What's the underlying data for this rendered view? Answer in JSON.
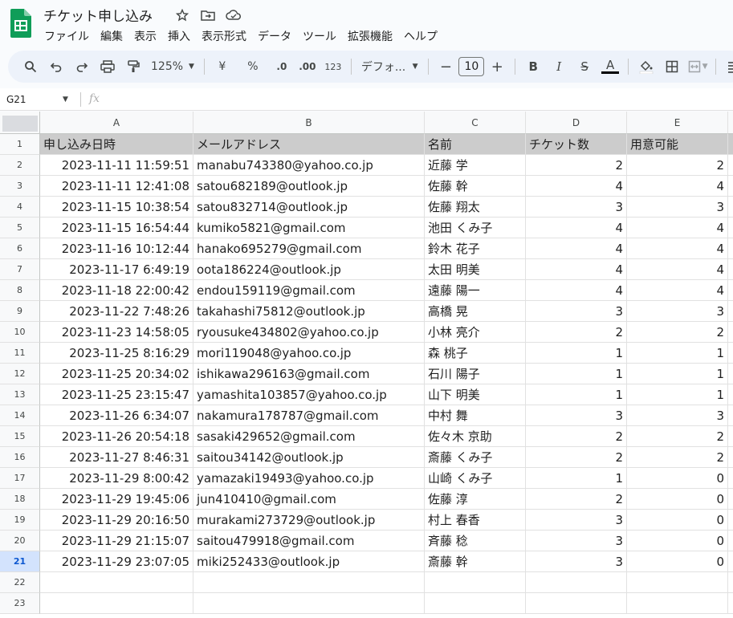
{
  "doc": {
    "title": "チケット申し込み",
    "icons": [
      "star-icon",
      "move-to-folder-icon",
      "cloud-status-icon"
    ]
  },
  "menu": [
    "ファイル",
    "編集",
    "表示",
    "挿入",
    "表示形式",
    "データ",
    "ツール",
    "拡張機能",
    "ヘルプ"
  ],
  "toolbar": {
    "zoom": "125%",
    "currency": "¥",
    "percent": "%",
    "decrease_decimal": ".0",
    "increase_decimal": ".00",
    "format_123": "123",
    "font": "デフォ...",
    "font_size": "10"
  },
  "formula_bar": {
    "cell_ref": "G21",
    "fx": "fx",
    "value": ""
  },
  "columns": [
    "A",
    "B",
    "C",
    "D",
    "E"
  ],
  "rows": [
    [
      "申し込み日時",
      "メールアドレス",
      "名前",
      "チケット数",
      "用意可能"
    ],
    [
      "2023-11-11 11:59:51",
      "manabu743380@yahoo.co.jp",
      "近藤 学",
      "2",
      "2"
    ],
    [
      "2023-11-11 12:41:08",
      "satou682189@outlook.jp",
      "佐藤 幹",
      "4",
      "4"
    ],
    [
      "2023-11-15 10:38:54",
      "satou832714@outlook.jp",
      "佐藤 翔太",
      "3",
      "3"
    ],
    [
      "2023-11-15 16:54:44",
      "kumiko5821@gmail.com",
      "池田 くみ子",
      "4",
      "4"
    ],
    [
      "2023-11-16 10:12:44",
      "hanako695279@gmail.com",
      "鈴木 花子",
      "4",
      "4"
    ],
    [
      "2023-11-17 6:49:19",
      "oota186224@outlook.jp",
      "太田 明美",
      "4",
      "4"
    ],
    [
      "2023-11-18 22:00:42",
      "endou159119@gmail.com",
      "遠藤 陽一",
      "4",
      "4"
    ],
    [
      "2023-11-22 7:48:26",
      "takahashi75812@outlook.jp",
      "高橋 晃",
      "3",
      "3"
    ],
    [
      "2023-11-23 14:58:05",
      "ryousuke434802@yahoo.co.jp",
      "小林 亮介",
      "2",
      "2"
    ],
    [
      "2023-11-25 8:16:29",
      "mori119048@yahoo.co.jp",
      "森 桃子",
      "1",
      "1"
    ],
    [
      "2023-11-25 20:34:02",
      "ishikawa296163@gmail.com",
      "石川 陽子",
      "1",
      "1"
    ],
    [
      "2023-11-25 23:15:47",
      "yamashita103857@yahoo.co.jp",
      "山下 明美",
      "1",
      "1"
    ],
    [
      "2023-11-26 6:34:07",
      "nakamura178787@gmail.com",
      "中村 舞",
      "3",
      "3"
    ],
    [
      "2023-11-26 20:54:18",
      "sasaki429652@gmail.com",
      "佐々木 京助",
      "2",
      "2"
    ],
    [
      "2023-11-27 8:46:31",
      "saitou34142@outlook.jp",
      "斎藤 くみ子",
      "2",
      "2"
    ],
    [
      "2023-11-29 8:00:42",
      "yamazaki19493@yahoo.co.jp",
      "山崎 くみ子",
      "1",
      "0"
    ],
    [
      "2023-11-29 19:45:06",
      "jun410410@gmail.com",
      "佐藤 淳",
      "2",
      "0"
    ],
    [
      "2023-11-29 20:16:50",
      "murakami273729@outlook.jp",
      "村上 春香",
      "3",
      "0"
    ],
    [
      "2023-11-29 21:15:07",
      "saitou479918@gmail.com",
      "斉藤 稔",
      "3",
      "0"
    ],
    [
      "2023-11-29 23:07:05",
      "miki252433@outlook.jp",
      "斎藤 幹",
      "3",
      "0"
    ],
    [
      "",
      "",
      "",
      "",
      ""
    ],
    [
      "",
      "",
      "",
      "",
      ""
    ]
  ],
  "active_row": 21,
  "colors": {
    "header_fill": "#cccccc",
    "active_row_header": "#d3e3fd",
    "sheets_green": "#0f9d58"
  }
}
